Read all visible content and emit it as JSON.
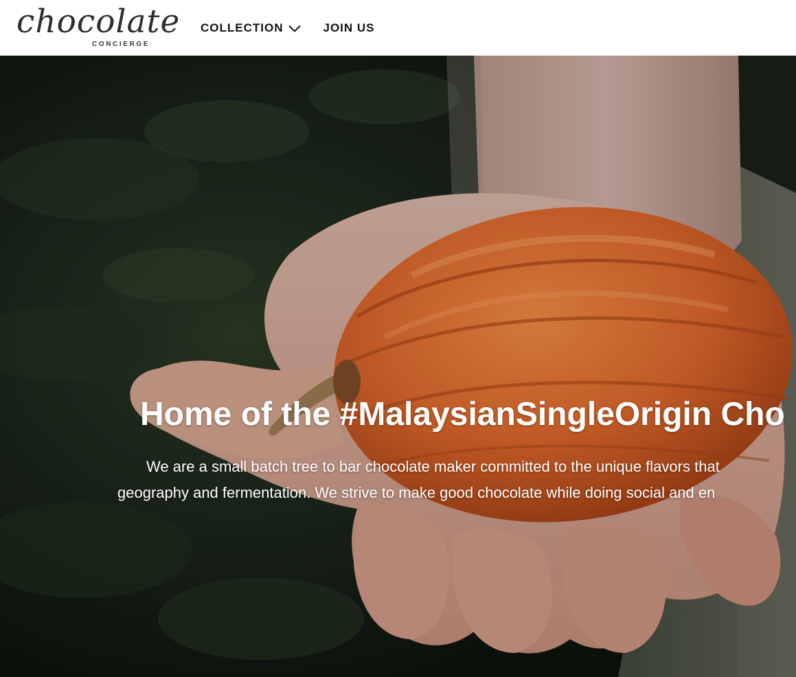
{
  "brand": {
    "logo_script": "chocolate",
    "logo_sub": "CONCIERGE"
  },
  "nav": {
    "collection_label": "COLLECTION",
    "join_label": "JOIN US",
    "collection_icon": "chevron-down-icon"
  },
  "hero": {
    "title": "Home of the #MalaysianSingleOrigin Cho",
    "text_line_1": "We are a small batch tree to bar chocolate maker committed to the unique flavors that",
    "text_line_2": "geography and fermentation. We strive to make good chocolate while doing social and en",
    "image": "hand-holding-cacao-pod",
    "colors": {
      "pod": "#d9652a",
      "skin": "#d9a38c",
      "foliage": "#1c2a1a"
    }
  }
}
